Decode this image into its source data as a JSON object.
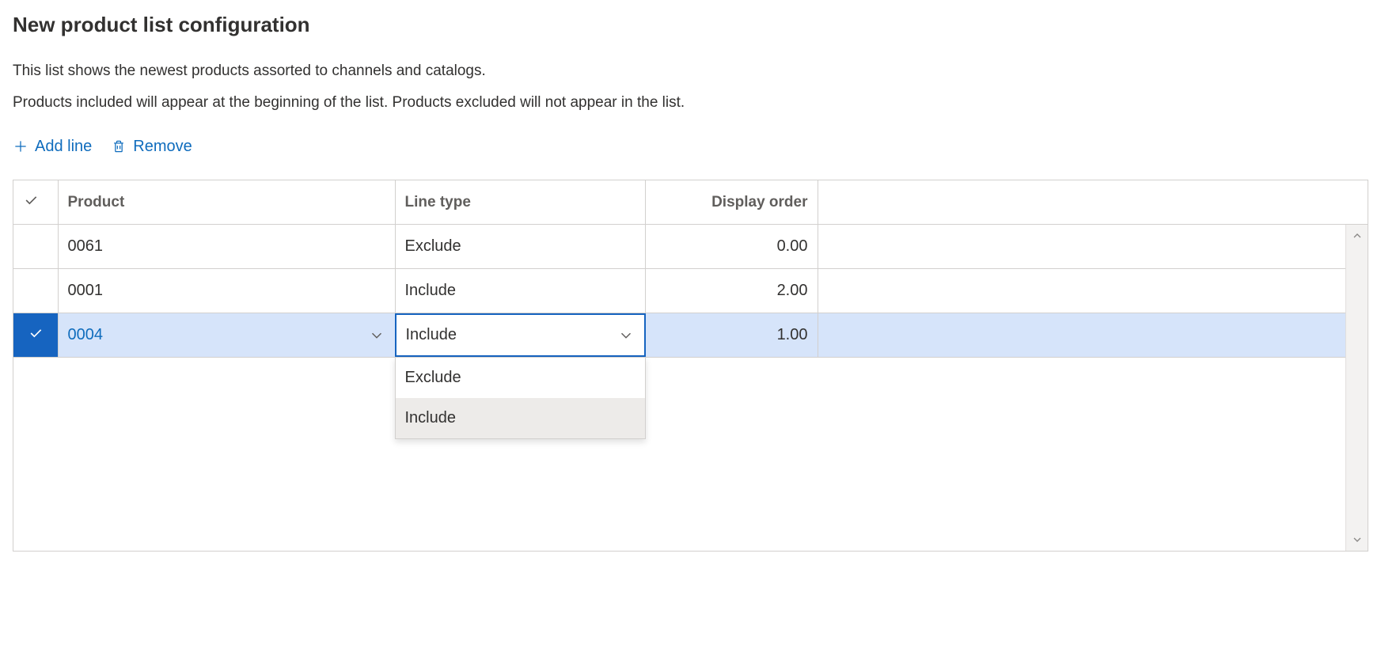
{
  "title": "New product list configuration",
  "description": {
    "line1": "This list shows the newest products assorted to channels and catalogs.",
    "line2": "Products included will appear at the beginning of the list. Products excluded will not appear in the list."
  },
  "toolbar": {
    "add_line": "Add line",
    "remove": "Remove"
  },
  "columns": {
    "product": "Product",
    "line_type": "Line type",
    "display_order": "Display order"
  },
  "rows": [
    {
      "product": "0061",
      "line_type": "Exclude",
      "display_order": "0.00",
      "selected": false
    },
    {
      "product": "0001",
      "line_type": "Include",
      "display_order": "2.00",
      "selected": false
    },
    {
      "product": "0004",
      "line_type": "Include",
      "display_order": "1.00",
      "selected": true
    }
  ],
  "dropdown": {
    "options": [
      "Exclude",
      "Include"
    ],
    "selected": "Include"
  }
}
